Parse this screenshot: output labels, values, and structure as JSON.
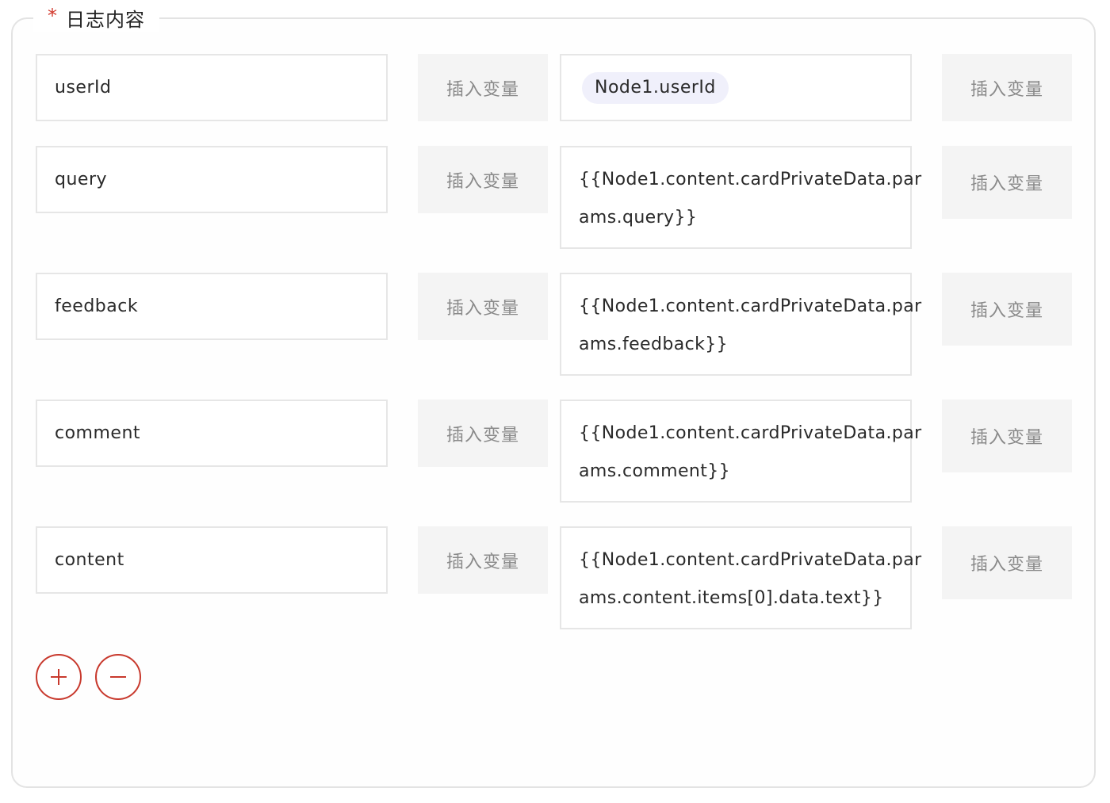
{
  "section": {
    "required_mark": "*",
    "title": "日志内容"
  },
  "rows": [
    {
      "key": "userId",
      "insert_left_label": "插入变量",
      "value_tag": "Node1.userId",
      "insert_right_label": "插入变量"
    },
    {
      "key": "query",
      "insert_left_label": "插入变量",
      "value_line1": "{{Node1.content.cardPrivateData.par",
      "value_line2": "ams.query}}",
      "insert_right_label": "插入变量"
    },
    {
      "key": "feedback",
      "insert_left_label": "插入变量",
      "value_line1": "{{Node1.content.cardPrivateData.par",
      "value_line2": "ams.feedback}}",
      "insert_right_label": "插入变量"
    },
    {
      "key": "comment",
      "insert_left_label": "插入变量",
      "value_line1": "{{Node1.content.cardPrivateData.par",
      "value_line2": "ams.comment}}",
      "insert_right_label": "插入变量"
    },
    {
      "key": "content",
      "insert_left_label": "插入变量",
      "value_line1": "{{Node1.content.cardPrivateData.par",
      "value_line2": "ams.content.items[0].data.text}}",
      "insert_right_label": "插入变量"
    }
  ],
  "controls": {
    "add_icon": "plus-icon",
    "remove_icon": "minus-icon"
  },
  "colors": {
    "accent": "#c8392d",
    "required": "#d23a2e",
    "tag_bg": "#f0f0fb",
    "button_bg": "#f4f4f4"
  }
}
